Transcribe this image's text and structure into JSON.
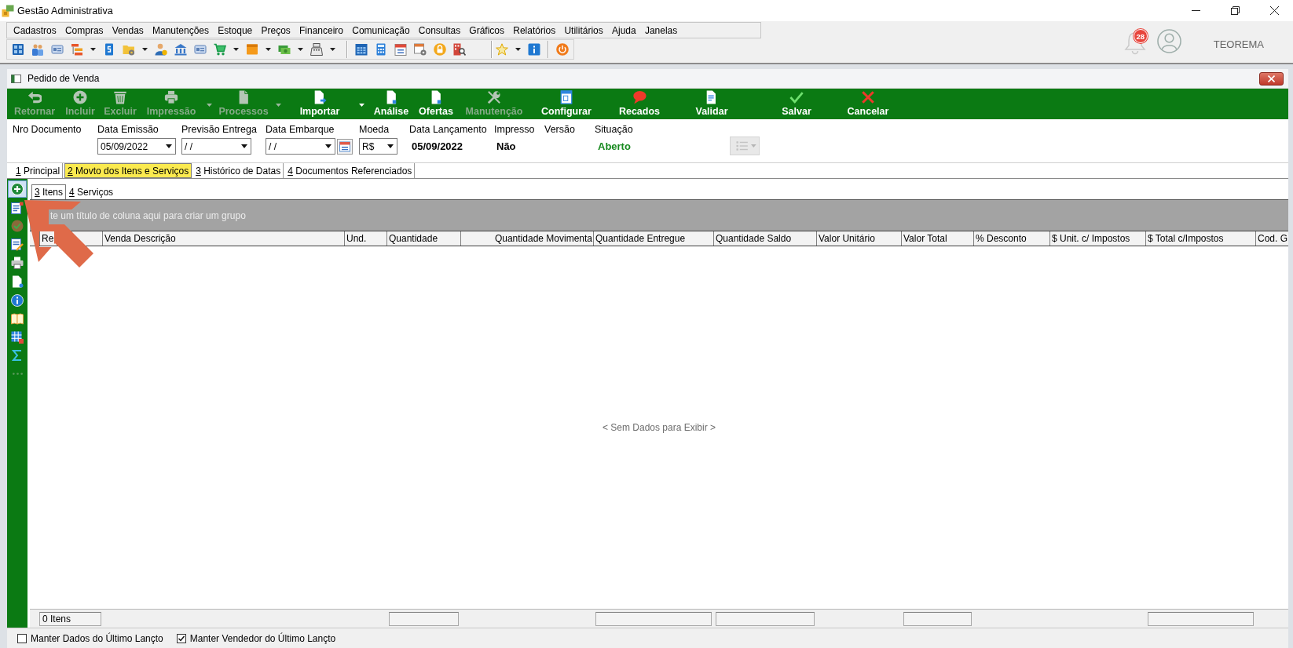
{
  "app": {
    "title": "Gestão Administrativa"
  },
  "menu": [
    "Cadastros",
    "Compras",
    "Vendas",
    "Manutenções",
    "Estoque",
    "Preços",
    "Financeiro",
    "Comunicação",
    "Consultas",
    "Gráficos",
    "Relatórios",
    "Utilitários",
    "Ajuda",
    "Janelas"
  ],
  "toolbar": {
    "groups": [
      {
        "items": [
          {
            "dropdown": false
          },
          {
            "dropdown": false
          },
          {
            "dropdown": false
          },
          {
            "dropdown": true
          },
          {
            "dropdown": false
          },
          {
            "dropdown": true
          },
          {
            "dropdown": false
          },
          {
            "dropdown": false
          },
          {
            "dropdown": false
          },
          {
            "dropdown": true
          },
          {
            "dropdown": true
          },
          {
            "dropdown": true
          },
          {
            "dropdown": true
          }
        ]
      },
      {
        "items": [
          {
            "dropdown": false
          },
          {
            "dropdown": false
          },
          {
            "dropdown": false
          },
          {
            "dropdown": false
          },
          {
            "dropdown": false
          },
          {
            "dropdown": false
          }
        ]
      },
      {
        "items": [
          {
            "dropdown": true
          },
          {
            "dropdown": false
          }
        ]
      },
      {
        "items": [
          {
            "dropdown": false
          }
        ]
      }
    ]
  },
  "user_area": {
    "notification_count": "28",
    "user_name": "TEOREMA"
  },
  "document_window": {
    "title": "Pedido de Venda",
    "actions": [
      {
        "label": "Retornar",
        "disabled": true,
        "dropdown": false
      },
      {
        "label": "Incluir",
        "disabled": true,
        "dropdown": false
      },
      {
        "label": "Excluir",
        "disabled": true,
        "dropdown": false
      },
      {
        "label": "Impressão",
        "disabled": true,
        "dropdown": true
      },
      {
        "label": "Processos",
        "disabled": true,
        "dropdown": true
      },
      {
        "label": "Importar",
        "disabled": false,
        "dropdown": true
      },
      {
        "label": "Análise",
        "disabled": false,
        "dropdown": false
      },
      {
        "label": "Ofertas",
        "disabled": false,
        "dropdown": false
      },
      {
        "label": "Manutenção",
        "disabled": true,
        "dropdown": false
      },
      {
        "label": "Configurar",
        "disabled": false,
        "dropdown": false
      },
      {
        "label": "Recados",
        "disabled": false,
        "dropdown": false
      },
      {
        "label": "Validar",
        "disabled": false,
        "dropdown": false
      },
      {
        "label": "Salvar",
        "disabled": false,
        "dropdown": false
      },
      {
        "label": "Cancelar",
        "disabled": false,
        "dropdown": false
      }
    ],
    "form": {
      "fields": [
        {
          "label": "Nro Documento",
          "kind": "label"
        },
        {
          "label": "Data Emissão",
          "kind": "combo",
          "value": "05/09/2022"
        },
        {
          "label": "Previsão Entrega",
          "kind": "combo",
          "value": "/ /"
        },
        {
          "label": "Data Embarque",
          "kind": "date_picker",
          "value": "/ /"
        },
        {
          "label": "Moeda",
          "kind": "combo",
          "value": "R$"
        },
        {
          "label": "Data Lançamento",
          "kind": "display",
          "value": "05/09/2022"
        },
        {
          "label": "Impresso",
          "kind": "display",
          "value": "Não"
        },
        {
          "label": "Versão",
          "kind": "label"
        },
        {
          "label": "Situação",
          "kind": "status",
          "value": "Aberto"
        }
      ],
      "list_button": {
        "disabled": true
      }
    },
    "tabs": [
      {
        "key": "1",
        "label": "Principal",
        "selected": false
      },
      {
        "key": "2",
        "label": "Movto dos Itens e Serviços",
        "selected": true
      },
      {
        "key": "3",
        "label": "Histórico de Datas",
        "selected": false
      },
      {
        "key": "4",
        "label": "Documentos Referenciados",
        "selected": false
      }
    ],
    "sidebar": [
      {
        "selected": true
      },
      {
        "selected": false
      },
      {
        "selected": false
      },
      {
        "selected": false
      },
      {
        "selected": false
      },
      {
        "selected": false
      },
      {
        "selected": false
      },
      {
        "selected": false
      },
      {
        "selected": false
      },
      {
        "selected": false
      },
      {
        "selected": false
      }
    ],
    "subtabs": [
      {
        "key": "3",
        "label": "Itens",
        "selected": true
      },
      {
        "key": "4",
        "label": "Serviços",
        "selected": false
      }
    ],
    "grid": {
      "group_panel": "te um título de coluna aqui para criar um grupo",
      "columns": [
        {
          "label": "Re",
          "total_field": true,
          "total": "0 Itens"
        },
        {
          "label": "Venda Descrição",
          "total_field": false
        },
        {
          "label": "Und.",
          "total_field": false
        },
        {
          "label": "Quantidade",
          "total_field": true
        },
        {
          "label": "Quantidade Movimenta",
          "total_field": false
        },
        {
          "label": "Quantidade Entregue",
          "total_field": true
        },
        {
          "label": "Quantidade Saldo",
          "total_field": true
        },
        {
          "label": "Valor Unitário",
          "total_field": false
        },
        {
          "label": "Valor Total",
          "total_field": true
        },
        {
          "label": "% Desconto",
          "total_field": false
        },
        {
          "label": "$ Unit. c/ Impostos",
          "total_field": false
        },
        {
          "label": "$ Total c/Impostos",
          "total_field": true
        },
        {
          "label": "Cod. G",
          "total_field": false
        }
      ],
      "empty_text": "< Sem Dados para Exibir >"
    },
    "options": [
      {
        "label": "Manter Dados do Último Lançto",
        "checked": false
      },
      {
        "label": "Manter Vendedor do Último Lançto",
        "checked": true
      }
    ]
  }
}
